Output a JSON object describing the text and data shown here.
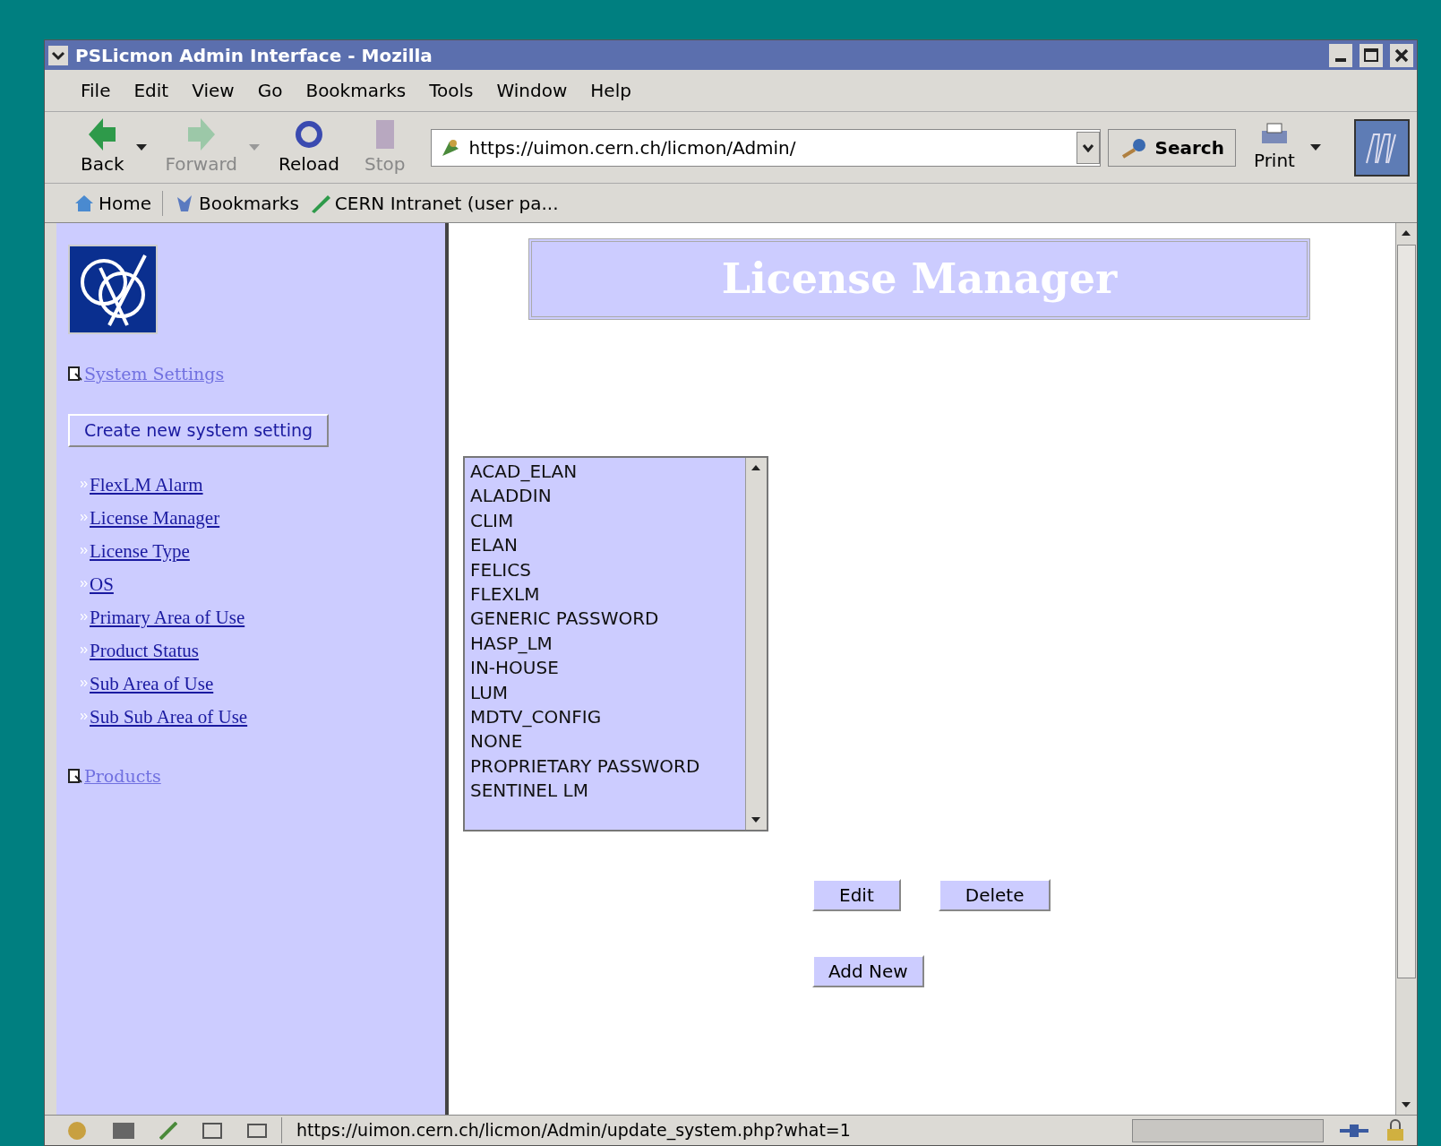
{
  "window": {
    "title": "PSLicmon Admin Interface - Mozilla"
  },
  "menu": [
    "File",
    "Edit",
    "View",
    "Go",
    "Bookmarks",
    "Tools",
    "Window",
    "Help"
  ],
  "nav_buttons": [
    {
      "label": "Back",
      "disabled": false,
      "kind": "back"
    },
    {
      "label": "Forward",
      "disabled": true,
      "kind": "forward"
    },
    {
      "label": "Reload",
      "disabled": false,
      "kind": "reload"
    },
    {
      "label": "Stop",
      "disabled": true,
      "kind": "stop"
    }
  ],
  "address": {
    "value": "https://uimon.cern.ch/licmon/Admin/"
  },
  "search_button": "Search",
  "print_button": "Print",
  "personal_toolbar": [
    {
      "label": "Home",
      "kind": "home"
    },
    {
      "label": "Bookmarks",
      "kind": "bookmarks"
    },
    {
      "label": "CERN Intranet (user pa...",
      "kind": "link"
    }
  ],
  "sidebar": {
    "sections": [
      {
        "title": "System Settings",
        "button": "Create new system setting",
        "links": [
          "FlexLM Alarm",
          "License Manager",
          "License Type",
          "OS",
          "Primary Area of Use",
          "Product Status",
          "Sub Area of Use",
          "Sub Sub Area of Use"
        ]
      },
      {
        "title": "Products"
      }
    ]
  },
  "page": {
    "heading": "License Manager",
    "list_items": [
      "ACAD_ELAN",
      "ALADDIN",
      "CLIM",
      "ELAN",
      "FELICS",
      "FLEXLM",
      "GENERIC PASSWORD",
      "HASP_LM",
      "IN-HOUSE",
      "LUM",
      "MDTV_CONFIG",
      "NONE",
      "PROPRIETARY PASSWORD",
      "SENTINEL LM"
    ],
    "buttons": [
      "Edit",
      "Delete"
    ],
    "add_button": "Add New"
  },
  "status_bar": {
    "text": "https://uimon.cern.ch/licmon/Admin/update_system.php?what=1"
  }
}
